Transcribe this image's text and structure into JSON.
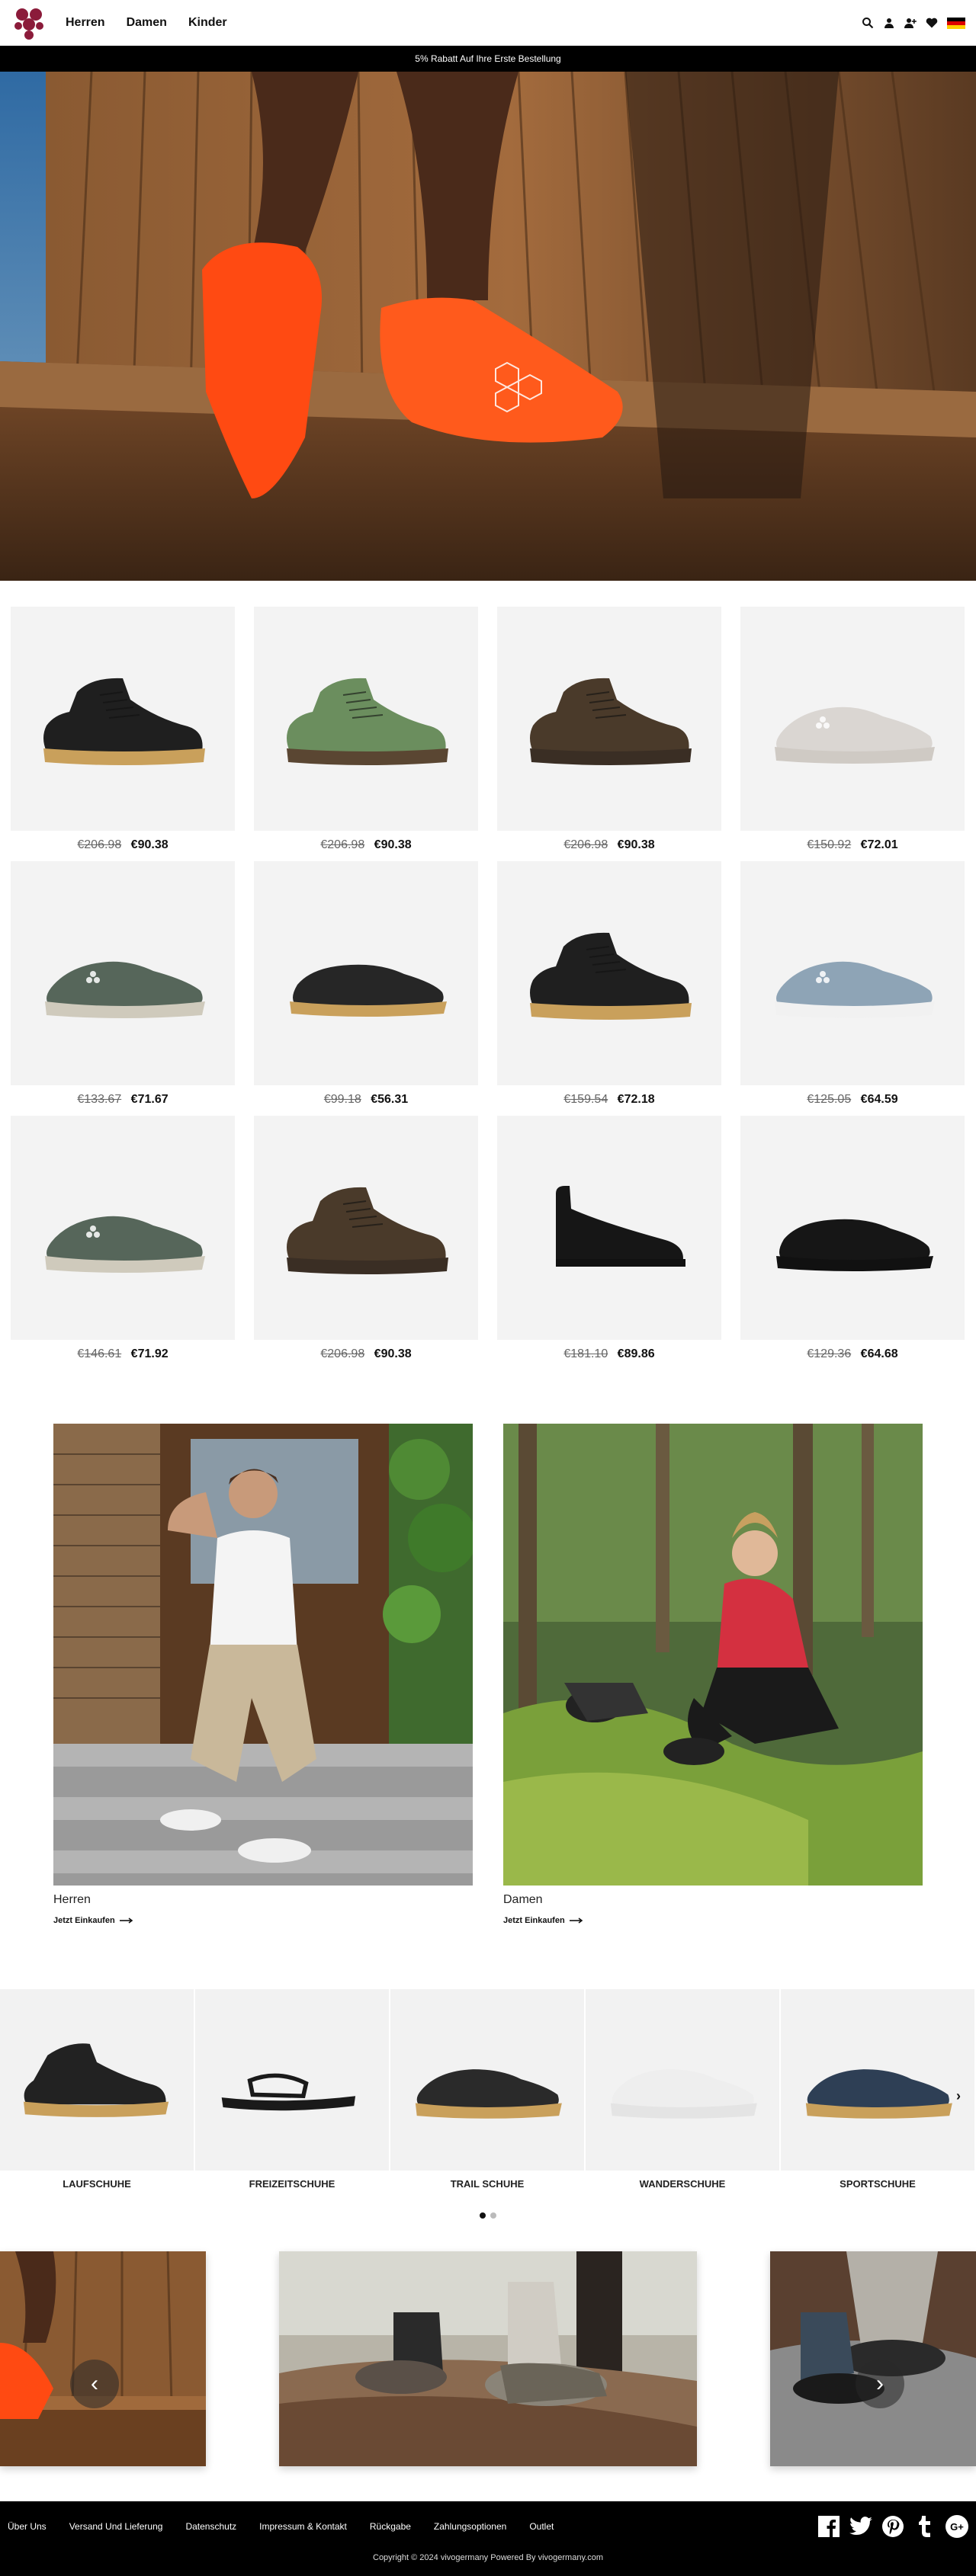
{
  "header": {
    "nav": [
      "Herren",
      "Damen",
      "Kinder"
    ],
    "icons": [
      "search-icon",
      "account-icon",
      "add-user-icon",
      "heart-icon",
      "german-flag-icon"
    ],
    "flag_colors": [
      "#000000",
      "#dd0000",
      "#ffce00"
    ],
    "logo_color": "#8b1b3a"
  },
  "promo": {
    "text": "5% Rabatt Auf Ihre Erste Bestellung"
  },
  "products": [
    {
      "old": "€206.98",
      "new": "€90.38",
      "color": "#1f1f1f",
      "sole": "#c9a05b"
    },
    {
      "old": "€206.98",
      "new": "€90.38",
      "color": "#6b8e5e",
      "sole": "#5a4632"
    },
    {
      "old": "€206.98",
      "new": "€90.38",
      "color": "#4a3a2a",
      "sole": "#3a2e24"
    },
    {
      "old": "€150.92",
      "new": "€72.01",
      "color": "#dad6d2",
      "sole": "#cfcac4"
    },
    {
      "old": "€133.67",
      "new": "€71.67",
      "color": "#56665a",
      "sole": "#cfcabc"
    },
    {
      "old": "€99.18",
      "new": "€56.31",
      "color": "#262626",
      "sole": "#c9a05b"
    },
    {
      "old": "€159.54",
      "new": "€72.18",
      "color": "#1f1f1f",
      "sole": "#c9a05b"
    },
    {
      "old": "€125.05",
      "new": "€64.59",
      "color": "#8ea4b6",
      "sole": "#f1f1f1"
    },
    {
      "old": "€146.61",
      "new": "€71.92",
      "color": "#56665a",
      "sole": "#cfcabc"
    },
    {
      "old": "€206.98",
      "new": "€90.38",
      "color": "#4a3a2a",
      "sole": "#3a2e24"
    },
    {
      "old": "€181.10",
      "new": "€89.86",
      "color": "#161616",
      "sole": "#111111"
    },
    {
      "old": "€129.36",
      "new": "€64.68",
      "color": "#161616",
      "sole": "#111111"
    }
  ],
  "banners": [
    {
      "title": "Herren",
      "link": "Jetzt Einkaufen"
    },
    {
      "title": "Damen",
      "link": "Jetzt Einkaufen"
    }
  ],
  "categories": [
    {
      "label": "LAUFSCHUHE",
      "color": "#222222",
      "sole": "#c9a05b"
    },
    {
      "label": "FREIZEITSCHUHE",
      "color": "#1a1a1a",
      "sole": "#1a1a1a"
    },
    {
      "label": "TRAIL SCHUHE",
      "color": "#2a2a2a",
      "sole": "#c9a05b"
    },
    {
      "label": "WANDERSCHUHE",
      "color": "#eeeeee",
      "sole": "#e4e4e4"
    },
    {
      "label": "SPORTSCHUHE",
      "color": "#2e3f55",
      "sole": "#c9a05b"
    }
  ],
  "carousel": {
    "next": "›",
    "prev_slider": "‹",
    "next_slider": "›",
    "pages": 2,
    "active": 0
  },
  "footer": {
    "links": [
      "Über Uns",
      "Versand Und Lieferung",
      "Datenschutz",
      "Impressum & Kontakt",
      "Rückgabe",
      "Zahlungsoptionen",
      "Outlet"
    ],
    "social": [
      "facebook-icon",
      "twitter-icon",
      "pinterest-icon",
      "tumblr-icon",
      "google-plus-icon"
    ],
    "copyright": "Copyright © 2024 vivogermany Powered By vivogermany.com"
  }
}
